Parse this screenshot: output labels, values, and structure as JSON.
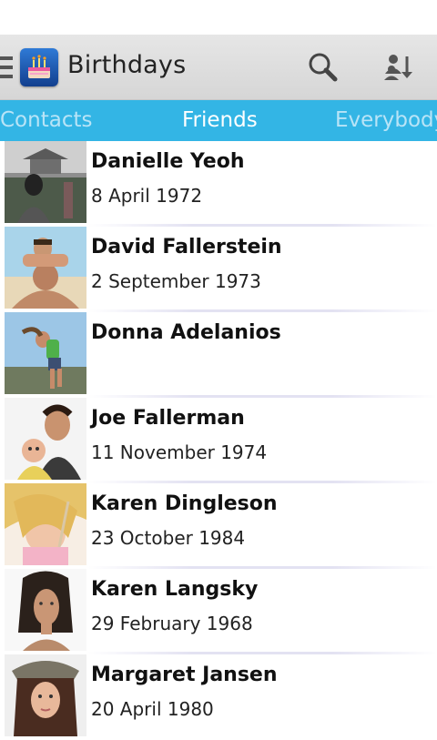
{
  "action_bar": {
    "title": "Birthdays",
    "icons": {
      "drawer": "menu-icon",
      "app": "birthday-cake-icon",
      "search": "search-icon",
      "sort": "sort-people-icon"
    }
  },
  "tabs": [
    {
      "label": "Contacts",
      "selected": false
    },
    {
      "label": "Friends",
      "selected": true
    },
    {
      "label": "Everybody",
      "selected": false
    }
  ],
  "contacts": [
    {
      "name": "Danielle Yeoh",
      "date": "8 April 1972"
    },
    {
      "name": "David Fallerstein",
      "date": "2 September 1973"
    },
    {
      "name": "Donna Adelanios",
      "date": ""
    },
    {
      "name": "Joe Fallerman",
      "date": "11 November 1974"
    },
    {
      "name": "Karen Dingleson",
      "date": "23 October 1984"
    },
    {
      "name": "Karen Langsky",
      "date": "29 February 1968"
    },
    {
      "name": "Margaret Jansen",
      "date": "20 April 1980"
    }
  ],
  "colors": {
    "tab_bar": "#33b5e5",
    "action_bar": "#dcdcdc",
    "tab_inactive_text": "#b8e4f7"
  }
}
